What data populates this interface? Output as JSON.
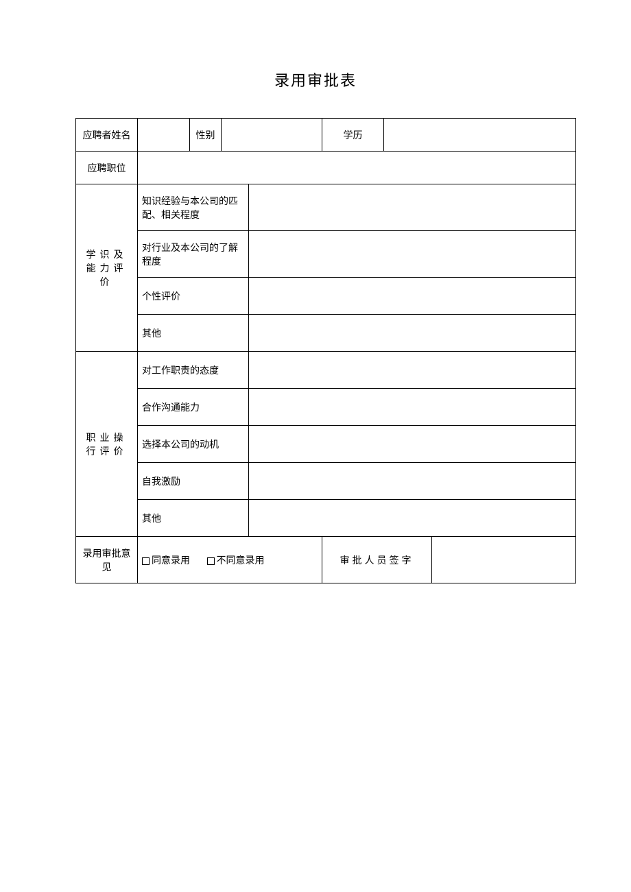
{
  "title": "录用审批表",
  "row1": {
    "name_label": "应聘者姓名",
    "gender_label": "性别",
    "education_label": "学历"
  },
  "row2": {
    "position_label": "应聘职位"
  },
  "section1": {
    "header": "学识及能力评价",
    "items": [
      "知识经验与本公司的匹配、相关程度",
      "对行业及本公司的了解程度",
      "个性评价",
      "其他"
    ]
  },
  "section2": {
    "header": "职业操行评价",
    "items": [
      "对工作职责的态度",
      "合作沟通能力",
      "选择本公司的动机",
      "自我激励",
      "其他"
    ]
  },
  "approval": {
    "label": "录用审批意见",
    "agree": "同意录用",
    "disagree": "不同意录用",
    "signer_label": "审批人员签字"
  }
}
